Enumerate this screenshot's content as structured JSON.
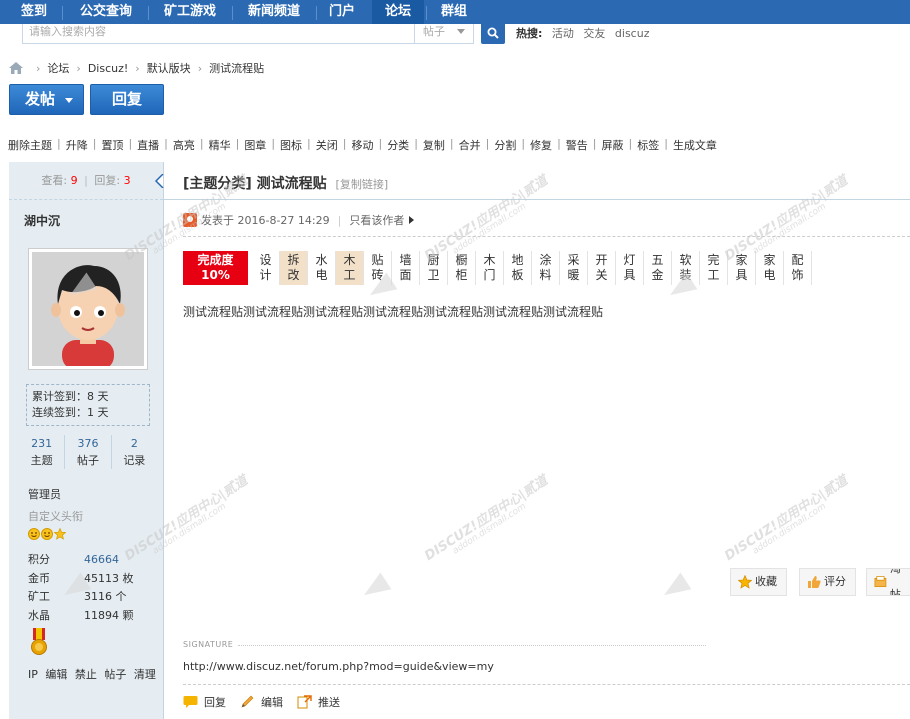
{
  "topnav": {
    "items": [
      "签到",
      "公交查询",
      "矿工游戏",
      "新闻频道",
      "门户",
      "论坛",
      "群组"
    ],
    "active_index": 5
  },
  "search": {
    "placeholder": "请输入搜索内容",
    "type": "帖子",
    "hot_label": "热搜:",
    "hot_items": [
      "活动",
      "交友",
      "discuz"
    ]
  },
  "breadcrumb": [
    "论坛",
    "Discuz!",
    "默认版块",
    "测试流程贴"
  ],
  "buttons": {
    "post": "发帖",
    "reply": "回复"
  },
  "modbar": [
    "删除主题",
    "升降",
    "置顶",
    "直播",
    "高亮",
    "精华",
    "图章",
    "图标",
    "关闭",
    "移动",
    "分类",
    "复制",
    "合并",
    "分割",
    "修复",
    "警告",
    "屏蔽",
    "标签",
    "生成文章"
  ],
  "left": {
    "views_label": "查看:",
    "views": "9",
    "sep": "|",
    "replies_label": "回复:",
    "replies": "3",
    "author": "湖中沉",
    "signin_total": "累计签到：8 天",
    "signin_streak": "连续签到：1 天",
    "stats": [
      {
        "value": "231",
        "label": "主题"
      },
      {
        "value": "376",
        "label": "帖子"
      },
      {
        "value": "2",
        "label": "记录"
      }
    ],
    "group": "管理员",
    "custom_title": "自定义头衔",
    "info": [
      {
        "k": "积分",
        "v": "46664",
        "link": true
      },
      {
        "k": "金币",
        "v": "45113 枚",
        "link": false
      },
      {
        "k": "矿工",
        "v": "3116 个",
        "link": false
      },
      {
        "k": "水晶",
        "v": "11894 颗",
        "link": false
      }
    ],
    "actions": [
      "IP",
      "编辑",
      "禁止",
      "帖子",
      "清理"
    ]
  },
  "post": {
    "title": "[主题分类] 测试流程贴",
    "copy_link": "[复制链接]",
    "meta_posted": "发表于 2016-8-27 14:29",
    "meta_only_author": "只看该作者",
    "progress_label_1": "完成度",
    "progress_label_2": "10%",
    "steps": [
      {
        "t": "设计",
        "done": false
      },
      {
        "t": "拆改",
        "done": true
      },
      {
        "t": "水电",
        "done": false
      },
      {
        "t": "木工",
        "done": true
      },
      {
        "t": "贴砖",
        "done": false
      },
      {
        "t": "墙面",
        "done": false
      },
      {
        "t": "厨卫",
        "done": false
      },
      {
        "t": "橱柜",
        "done": false
      },
      {
        "t": "木门",
        "done": false
      },
      {
        "t": "地板",
        "done": false
      },
      {
        "t": "涂料",
        "done": false
      },
      {
        "t": "采暖",
        "done": false
      },
      {
        "t": "开关",
        "done": false
      },
      {
        "t": "灯具",
        "done": false
      },
      {
        "t": "五金",
        "done": false
      },
      {
        "t": "软装",
        "done": false
      },
      {
        "t": "完工",
        "done": false
      },
      {
        "t": "家具",
        "done": false
      },
      {
        "t": "家电",
        "done": false
      },
      {
        "t": "配饰",
        "done": false
      }
    ],
    "content": "测试流程贴测试流程贴测试流程贴测试流程贴测试流程贴测试流程贴测试流程贴",
    "action_favorite": "收藏",
    "action_rate": "评分",
    "action_taobao": "淘帖",
    "signature_label": "SIGNATURE",
    "signature_url": "http://www.discuz.net/forum.php?mod=guide&view=my",
    "bottom_reply": "回复",
    "bottom_edit": "编辑",
    "bottom_push": "推送"
  },
  "watermark": {
    "brand": "DISCUZ!应用中心|贰道",
    "domain": "addon.dismall.com"
  },
  "colors": {
    "nav": "#2b6ab3",
    "sidebar": "#e5edf2",
    "progress": "#e60012",
    "step_done": "#f3e0c8"
  }
}
